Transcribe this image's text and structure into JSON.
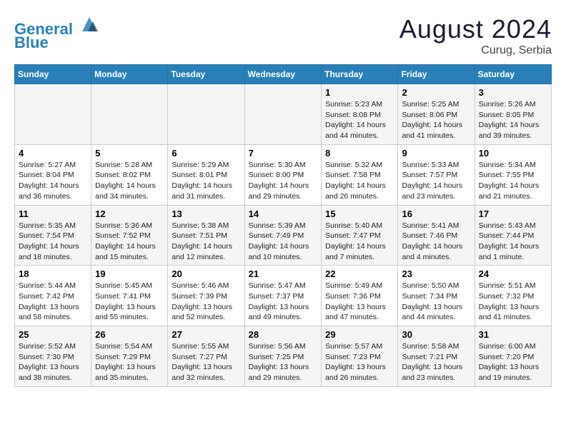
{
  "header": {
    "logo_line1": "General",
    "logo_line2": "Blue",
    "month": "August 2024",
    "location": "Curug, Serbia"
  },
  "weekdays": [
    "Sunday",
    "Monday",
    "Tuesday",
    "Wednesday",
    "Thursday",
    "Friday",
    "Saturday"
  ],
  "weeks": [
    [
      {
        "day": "",
        "info": ""
      },
      {
        "day": "",
        "info": ""
      },
      {
        "day": "",
        "info": ""
      },
      {
        "day": "",
        "info": ""
      },
      {
        "day": "1",
        "info": "Sunrise: 5:23 AM\nSunset: 8:08 PM\nDaylight: 14 hours\nand 44 minutes."
      },
      {
        "day": "2",
        "info": "Sunrise: 5:25 AM\nSunset: 8:06 PM\nDaylight: 14 hours\nand 41 minutes."
      },
      {
        "day": "3",
        "info": "Sunrise: 5:26 AM\nSunset: 8:05 PM\nDaylight: 14 hours\nand 39 minutes."
      }
    ],
    [
      {
        "day": "4",
        "info": "Sunrise: 5:27 AM\nSunset: 8:04 PM\nDaylight: 14 hours\nand 36 minutes."
      },
      {
        "day": "5",
        "info": "Sunrise: 5:28 AM\nSunset: 8:02 PM\nDaylight: 14 hours\nand 34 minutes."
      },
      {
        "day": "6",
        "info": "Sunrise: 5:29 AM\nSunset: 8:01 PM\nDaylight: 14 hours\nand 31 minutes."
      },
      {
        "day": "7",
        "info": "Sunrise: 5:30 AM\nSunset: 8:00 PM\nDaylight: 14 hours\nand 29 minutes."
      },
      {
        "day": "8",
        "info": "Sunrise: 5:32 AM\nSunset: 7:58 PM\nDaylight: 14 hours\nand 26 minutes."
      },
      {
        "day": "9",
        "info": "Sunrise: 5:33 AM\nSunset: 7:57 PM\nDaylight: 14 hours\nand 23 minutes."
      },
      {
        "day": "10",
        "info": "Sunrise: 5:34 AM\nSunset: 7:55 PM\nDaylight: 14 hours\nand 21 minutes."
      }
    ],
    [
      {
        "day": "11",
        "info": "Sunrise: 5:35 AM\nSunset: 7:54 PM\nDaylight: 14 hours\nand 18 minutes."
      },
      {
        "day": "12",
        "info": "Sunrise: 5:36 AM\nSunset: 7:52 PM\nDaylight: 14 hours\nand 15 minutes."
      },
      {
        "day": "13",
        "info": "Sunrise: 5:38 AM\nSunset: 7:51 PM\nDaylight: 14 hours\nand 12 minutes."
      },
      {
        "day": "14",
        "info": "Sunrise: 5:39 AM\nSunset: 7:49 PM\nDaylight: 14 hours\nand 10 minutes."
      },
      {
        "day": "15",
        "info": "Sunrise: 5:40 AM\nSunset: 7:47 PM\nDaylight: 14 hours\nand 7 minutes."
      },
      {
        "day": "16",
        "info": "Sunrise: 5:41 AM\nSunset: 7:46 PM\nDaylight: 14 hours\nand 4 minutes."
      },
      {
        "day": "17",
        "info": "Sunrise: 5:43 AM\nSunset: 7:44 PM\nDaylight: 14 hours\nand 1 minute."
      }
    ],
    [
      {
        "day": "18",
        "info": "Sunrise: 5:44 AM\nSunset: 7:42 PM\nDaylight: 13 hours\nand 58 minutes."
      },
      {
        "day": "19",
        "info": "Sunrise: 5:45 AM\nSunset: 7:41 PM\nDaylight: 13 hours\nand 55 minutes."
      },
      {
        "day": "20",
        "info": "Sunrise: 5:46 AM\nSunset: 7:39 PM\nDaylight: 13 hours\nand 52 minutes."
      },
      {
        "day": "21",
        "info": "Sunrise: 5:47 AM\nSunset: 7:37 PM\nDaylight: 13 hours\nand 49 minutes."
      },
      {
        "day": "22",
        "info": "Sunrise: 5:49 AM\nSunset: 7:36 PM\nDaylight: 13 hours\nand 47 minutes."
      },
      {
        "day": "23",
        "info": "Sunrise: 5:50 AM\nSunset: 7:34 PM\nDaylight: 13 hours\nand 44 minutes."
      },
      {
        "day": "24",
        "info": "Sunrise: 5:51 AM\nSunset: 7:32 PM\nDaylight: 13 hours\nand 41 minutes."
      }
    ],
    [
      {
        "day": "25",
        "info": "Sunrise: 5:52 AM\nSunset: 7:30 PM\nDaylight: 13 hours\nand 38 minutes."
      },
      {
        "day": "26",
        "info": "Sunrise: 5:54 AM\nSunset: 7:29 PM\nDaylight: 13 hours\nand 35 minutes."
      },
      {
        "day": "27",
        "info": "Sunrise: 5:55 AM\nSunset: 7:27 PM\nDaylight: 13 hours\nand 32 minutes."
      },
      {
        "day": "28",
        "info": "Sunrise: 5:56 AM\nSunset: 7:25 PM\nDaylight: 13 hours\nand 29 minutes."
      },
      {
        "day": "29",
        "info": "Sunrise: 5:57 AM\nSunset: 7:23 PM\nDaylight: 13 hours\nand 26 minutes."
      },
      {
        "day": "30",
        "info": "Sunrise: 5:58 AM\nSunset: 7:21 PM\nDaylight: 13 hours\nand 23 minutes."
      },
      {
        "day": "31",
        "info": "Sunrise: 6:00 AM\nSunset: 7:20 PM\nDaylight: 13 hours\nand 19 minutes."
      }
    ]
  ]
}
